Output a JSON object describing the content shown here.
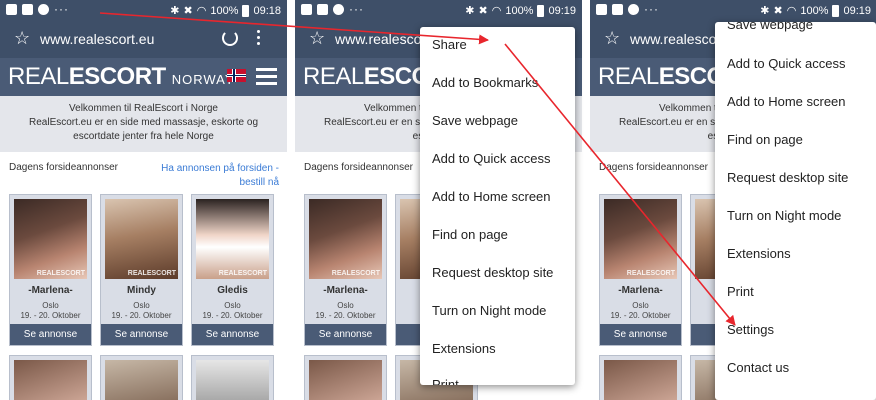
{
  "status": {
    "battery_pct": "100%",
    "time_1": "09:18",
    "time_2": "09:19",
    "time_3": "09:19"
  },
  "browser": {
    "url": "www.realescort.eu",
    "url_2": "www.realescort."
  },
  "site": {
    "logo_part1": "REAL",
    "logo_part2": "ESCORT",
    "logo_part3": "NORWAY",
    "welcome_line1": "Velkommen til RealEscort i Norge",
    "welcome_line2": "RealEscort.eu er en side med massasje, eskorte og escortdate jenter fra hele Norge",
    "welcome_line2_clipped": "RealEscort.eu er en side med massasje, eskorte og escortdate j",
    "section_label": "Dagens forsideannonser",
    "promo_link": "Ha annonsen på forsiden - bestill nå",
    "watermark": "REALESCORT",
    "cards": [
      {
        "name": "-Marlena-",
        "city": "Oslo",
        "dates": "19. - 20. Oktober",
        "button": "Se annonse"
      },
      {
        "name": "Mindy",
        "city": "Oslo",
        "dates": "19. - 20. Oktober",
        "button": "Se annonse"
      },
      {
        "name": "Gledis",
        "city": "Oslo",
        "dates": "19. - 20. Oktober",
        "button": "Se annonse"
      }
    ]
  },
  "menu_panel2": {
    "items": [
      "Share",
      "Add to Bookmarks",
      "Save webpage",
      "Add to Quick access",
      "Add to Home screen",
      "Find on page",
      "Request desktop site",
      "Turn on Night mode",
      "Extensions",
      "Print"
    ]
  },
  "menu_panel3": {
    "items": [
      "Save webpage",
      "Add to Quick access",
      "Add to Home screen",
      "Find on page",
      "Request desktop site",
      "Turn on Night mode",
      "Extensions",
      "Print",
      "Settings",
      "Contact us"
    ]
  },
  "colors": {
    "toolbar": "#3e4f68",
    "header": "#4a5b76",
    "arrow": "#e8262d",
    "link": "#3a7bd5"
  }
}
